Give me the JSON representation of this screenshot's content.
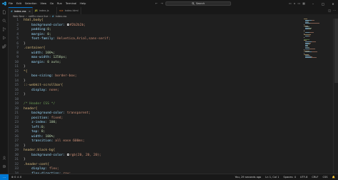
{
  "menu": [
    "File",
    "Edit",
    "Selection",
    "View",
    "Go",
    "Run",
    "Terminal",
    "Help"
  ],
  "search": {
    "label": "Search"
  },
  "tabs": [
    {
      "name": "index.css",
      "kind": "css",
      "active": true
    },
    {
      "name": "index.js",
      "kind": "js",
      "active": false
    },
    {
      "name": "index.html",
      "kind": "html",
      "active": false
    }
  ],
  "breadcrumb": [
    "Web Nest",
    "netflix clone live",
    "index.css"
  ],
  "code_lines": [
    [
      [
        "html,body{",
        "t-sel"
      ]
    ],
    [
      [
        "    background-color: ",
        "t-prop"
      ],
      [
        "#2b2b2b;",
        "t-val",
        "#2b2b2b"
      ]
    ],
    [
      [
        "    padding:",
        "t-prop"
      ],
      [
        "0;",
        "t-num"
      ]
    ],
    [
      [
        "    margin: ",
        "t-prop"
      ],
      [
        "0;",
        "t-num"
      ]
    ],
    [
      [
        "    font-family: ",
        "t-prop"
      ],
      [
        "Helvetica,Arial,sans-serif;",
        "t-val"
      ]
    ],
    [
      [
        "}",
        "t-punc"
      ]
    ],
    [
      [
        ".container{",
        "t-sel"
      ]
    ],
    [
      [
        "    width: ",
        "t-prop"
      ],
      [
        "100%;",
        "t-num"
      ]
    ],
    [
      [
        "    max-width: ",
        "t-prop"
      ],
      [
        "1250px;",
        "t-num"
      ]
    ],
    [
      [
        "    margin: ",
        "t-prop"
      ],
      [
        "0 auto;",
        "t-num"
      ]
    ],
    [
      [
        "}",
        "t-punc"
      ]
    ],
    [
      [
        "*{",
        "t-sel"
      ]
    ],
    [
      [
        "    box-sizing: ",
        "t-prop"
      ],
      [
        "border-box;",
        "t-val"
      ]
    ],
    [
      [
        "}",
        "t-punc"
      ]
    ],
    [
      [
        "::-webkit-scrollbar{",
        "t-sel"
      ]
    ],
    [
      [
        "    display: ",
        "t-prop"
      ],
      [
        "none;",
        "t-val"
      ]
    ],
    [
      [
        "}",
        "t-punc"
      ]
    ],
    [],
    [
      [
        "/* Header CSS */",
        "t-com"
      ]
    ],
    [
      [
        "header{",
        "t-sel"
      ]
    ],
    [
      [
        "    background-color: ",
        "t-prop"
      ],
      [
        "transparent;",
        "t-val"
      ]
    ],
    [
      [
        "    position: ",
        "t-prop"
      ],
      [
        "fixed;",
        "t-val"
      ]
    ],
    [
      [
        "    z-index: ",
        "t-prop"
      ],
      [
        "100;",
        "t-num"
      ]
    ],
    [
      [
        "    left:",
        "t-prop"
      ],
      [
        "0;",
        "t-num"
      ]
    ],
    [
      [
        "    top: ",
        "t-prop"
      ],
      [
        "0;",
        "t-num"
      ]
    ],
    [
      [
        "    width: ",
        "t-prop"
      ],
      [
        "100%;",
        "t-num"
      ]
    ],
    [
      [
        "    transition: ",
        "t-prop"
      ],
      [
        "all ease 600ms;",
        "t-val"
      ]
    ],
    [
      [
        "}",
        "t-punc"
      ]
    ],
    [
      [
        "header.black-bg{",
        "t-sel"
      ]
    ],
    [
      [
        "    background-color: ",
        "t-prop"
      ],
      [
        "rgb(20, 20, 20);",
        "t-val",
        "#141414"
      ]
    ],
    [
      [
        "}",
        "t-punc"
      ]
    ],
    [
      [
        ".header-cont{",
        "t-sel"
      ]
    ],
    [
      [
        "    display: ",
        "t-prop"
      ],
      [
        "flex;",
        "t-val"
      ]
    ],
    [
      [
        "    flex-direction: ",
        "t-prop"
      ],
      [
        "row;",
        "t-val"
      ]
    ],
    [
      [
        "    justify-content: ",
        "t-prop"
      ],
      [
        "space-between;",
        "t-val"
      ]
    ]
  ],
  "status": {
    "errors": "0",
    "warnings": "0",
    "git": "You, 29 seconds ago",
    "position": "Ln 1, Col 1",
    "spaces": "Spaces: 4",
    "encoding": "UTF-8",
    "eol": "CRLF",
    "language": "CSS"
  },
  "colors": {
    "accent": "#0078d4",
    "background": "#1f1f1f"
  }
}
